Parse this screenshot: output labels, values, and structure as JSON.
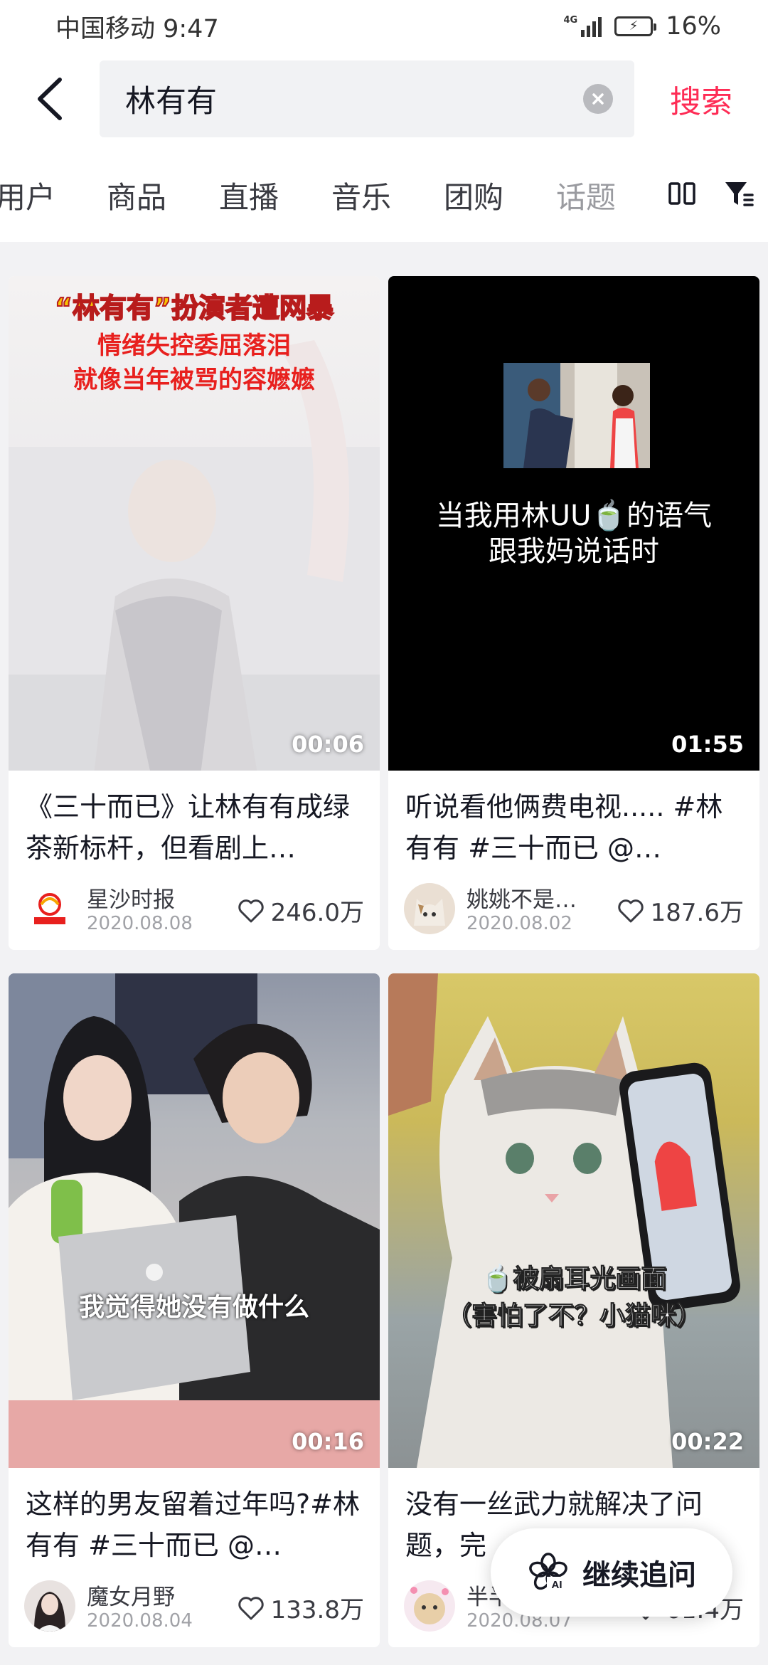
{
  "status_bar": {
    "carrier_time": "中国移动 9:47",
    "network": "4G",
    "battery": "16%"
  },
  "search": {
    "query": "林有有",
    "search_label": "搜索"
  },
  "tabs": [
    "用户",
    "商品",
    "直播",
    "音乐",
    "团购",
    "话题"
  ],
  "results": [
    {
      "thumb_lines": [
        "“林有有”扮演者遭网暴",
        "情绪失控委屈落泪",
        "就像当年被骂的容嬷嬷"
      ],
      "duration": "00:06",
      "title": "《三十而已》让林有有成绿茶新标杆，但看剧上…",
      "author": "星沙时报",
      "date": "2020.08.08",
      "likes": "246.0万"
    },
    {
      "thumb_lines": [
        "当我用林UU🍵的语气",
        "跟我妈说话时"
      ],
      "duration": "01:55",
      "title": "听说看他俩费电视..... #林有有 #三十而已 @…",
      "author": "姚姚不是…",
      "date": "2020.08.02",
      "likes": "187.6万"
    },
    {
      "thumb_lines": [
        "我觉得她没有做什么"
      ],
      "duration": "00:16",
      "title": "这样的男友留着过年吗?#林有有 #三十而已 @…",
      "author": "魔女月野",
      "date": "2020.08.04",
      "likes": "133.8万"
    },
    {
      "thumb_lines": [
        "🍵被扇耳光画面",
        "（害怕了不？小猫咪）"
      ],
      "duration": "00:22",
      "title": "没有一丝武力就解决了问题，完",
      "author": "半半",
      "date": "2020.08.07",
      "likes": "61.4万"
    }
  ],
  "float_button": {
    "label": "继续追问",
    "icon_text": "AI"
  },
  "colors": {
    "accent": "#fe2c55",
    "text": "#161823",
    "muted": "#a1a2a7"
  }
}
